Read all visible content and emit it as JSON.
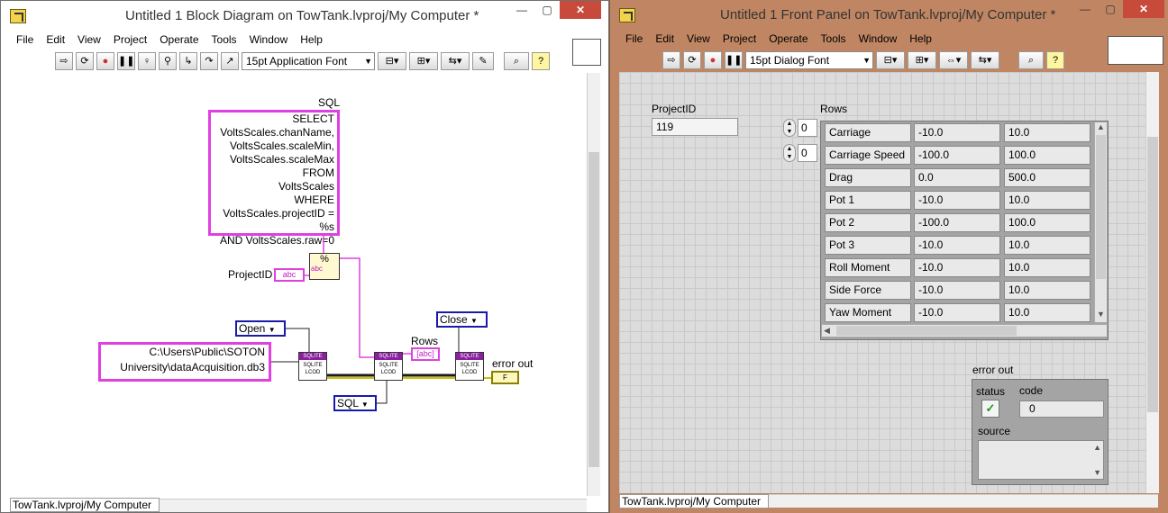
{
  "block_diagram": {
    "title": "Untitled 1 Block Diagram on TowTank.lvproj/My Computer *",
    "menu": [
      "File",
      "Edit",
      "View",
      "Project",
      "Operate",
      "Tools",
      "Window",
      "Help"
    ],
    "font": "15pt Application Font",
    "sql_label": "SQL",
    "sql_lines": [
      "SELECT",
      "VoltsScales.chanName,",
      "VoltsScales.scaleMin,",
      "VoltsScales.scaleMax",
      "FROM",
      "VoltsScales",
      "WHERE",
      "VoltsScales.projectID = %s",
      "AND VoltsScales.raw=0"
    ],
    "projectid_label": "ProjectID",
    "projectid_terminal": "abc",
    "format_node": "%",
    "format_abc": "abc",
    "open_enum": "Open",
    "close_enum": "Close",
    "sql_enum": "SQL",
    "path_lines": [
      "C:\\Users\\Public\\SOTON",
      "University\\dataAcquisition.db3"
    ],
    "rows_label": "Rows",
    "rows_terminal": "[abc]",
    "error_out_label": "error out",
    "error_terminal": "F",
    "subvi_top": "SQLITE",
    "subvi_body": [
      "SQLITE",
      "LCOD"
    ],
    "status": "TowTank.lvproj/My Computer"
  },
  "front_panel": {
    "title": "Untitled 1 Front Panel on TowTank.lvproj/My Computer *",
    "menu": [
      "File",
      "Edit",
      "View",
      "Project",
      "Operate",
      "Tools",
      "Window",
      "Help"
    ],
    "font": "15pt Dialog Font",
    "projectid_label": "ProjectID",
    "projectid_value": "119",
    "rows_label": "Rows",
    "row_index": "0",
    "col_index": "0",
    "rows": [
      [
        "Carriage",
        "-10.0",
        "10.0"
      ],
      [
        "Carriage Speed",
        "-100.0",
        "100.0"
      ],
      [
        "Drag",
        "0.0",
        "500.0"
      ],
      [
        "Pot 1",
        "-10.0",
        "10.0"
      ],
      [
        "Pot 2",
        "-100.0",
        "100.0"
      ],
      [
        "Pot 3",
        "-10.0",
        "10.0"
      ],
      [
        "Roll Moment",
        "-10.0",
        "10.0"
      ],
      [
        "Side Force",
        "-10.0",
        "10.0"
      ],
      [
        "Yaw Moment",
        "-10.0",
        "10.0"
      ]
    ],
    "error_out": {
      "label": "error out",
      "status_label": "status",
      "code_label": "code",
      "code_value": "0",
      "source_label": "source",
      "status_glyph": "✓"
    },
    "status": "TowTank.lvproj/My Computer"
  }
}
